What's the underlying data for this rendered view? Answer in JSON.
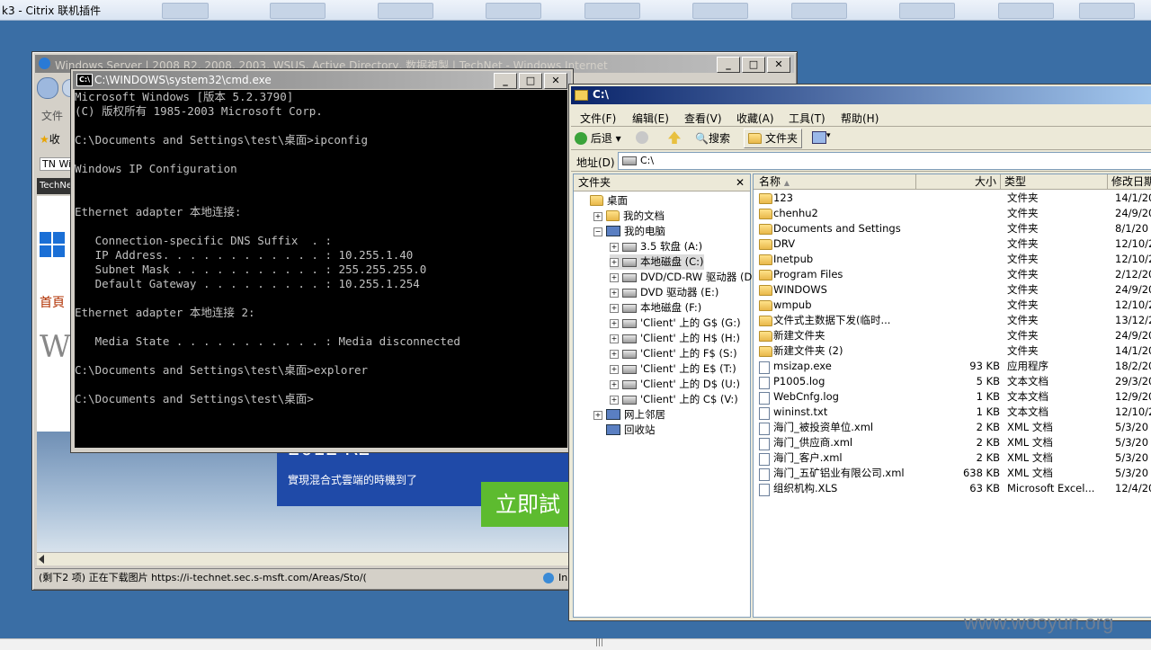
{
  "host": {
    "title": "k3 - Citrix 联机插件",
    "watermark": "www.wooyun.org"
  },
  "ie": {
    "title": "Windows Server | 2008 R2, 2008, 2003, WSUS, Active Directory, 数据複製 | TechNet - Windows Internet",
    "menu_left": "文件",
    "favorites": "收",
    "tab_label": "TN Wi",
    "site_label": "TechNe",
    "home_link": "首頁",
    "big_letter": "W",
    "banner_version": "2012 R2",
    "banner_subtitle": "實現混合式雲端的時機到了",
    "banner_button": "立即試",
    "status_text": "(剩下2 项) 正在下载图片 https://i-technet.sec.s-msft.com/Areas/Sto/(",
    "status_zone": "In"
  },
  "cmd": {
    "title": "C:\\WINDOWS\\system32\\cmd.exe",
    "lines": [
      "Microsoft Windows [版本 5.2.3790]",
      "(C) 版权所有 1985-2003 Microsoft Corp.",
      "",
      "C:\\Documents and Settings\\test\\桌面>ipconfig",
      "",
      "Windows IP Configuration",
      "",
      "",
      "Ethernet adapter 本地连接:",
      "",
      "   Connection-specific DNS Suffix  . :",
      "   IP Address. . . . . . . . . . . . : 10.255.1.40",
      "   Subnet Mask . . . . . . . . . . . : 255.255.255.0",
      "   Default Gateway . . . . . . . . . : 10.255.1.254",
      "",
      "Ethernet adapter 本地连接 2:",
      "",
      "   Media State . . . . . . . . . . . : Media disconnected",
      "",
      "C:\\Documents and Settings\\test\\桌面>explorer",
      "",
      "C:\\Documents and Settings\\test\\桌面>"
    ]
  },
  "explorer": {
    "title": "C:\\",
    "menu": [
      "文件(F)",
      "编辑(E)",
      "查看(V)",
      "收藏(A)",
      "工具(T)",
      "帮助(H)"
    ],
    "toolbar": {
      "back": "后退",
      "search": "搜索",
      "folders": "文件夹"
    },
    "address_label": "地址(D)",
    "address_value": "C:\\",
    "folders_pane_title": "文件夹",
    "tree": [
      {
        "label": "桌面",
        "icon": "desktop-icon",
        "expander": ""
      },
      {
        "label": "我的文档",
        "icon": "folder-icon",
        "expander": "+"
      },
      {
        "label": "我的电脑",
        "icon": "computer-icon",
        "expander": "-"
      },
      {
        "label": "3.5 软盘 (A:)",
        "icon": "floppy-icon",
        "expander": "+"
      },
      {
        "label": "本地磁盘 (C:)",
        "icon": "drive-icon",
        "expander": "+"
      },
      {
        "label": "DVD/CD-RW 驱动器 (D:)",
        "icon": "cd-drive-icon",
        "expander": "+"
      },
      {
        "label": "DVD 驱动器 (E:)",
        "icon": "cd-drive-icon",
        "expander": "+"
      },
      {
        "label": "本地磁盘 (F:)",
        "icon": "drive-icon",
        "expander": "+"
      },
      {
        "label": "'Client' 上的 G$ (G:)",
        "icon": "network-drive-icon",
        "expander": "+"
      },
      {
        "label": "'Client' 上的 H$ (H:)",
        "icon": "network-drive-icon",
        "expander": "+"
      },
      {
        "label": "'Client' 上的 F$ (S:)",
        "icon": "network-drive-icon",
        "expander": "+"
      },
      {
        "label": "'Client' 上的 E$ (T:)",
        "icon": "network-drive-icon",
        "expander": "+"
      },
      {
        "label": "'Client' 上的 D$ (U:)",
        "icon": "network-drive-icon",
        "expander": "+"
      },
      {
        "label": "'Client' 上的 C$ (V:)",
        "icon": "network-drive-icon",
        "expander": "+"
      },
      {
        "label": "网上邻居",
        "icon": "network-icon",
        "expander": "+"
      },
      {
        "label": "回收站",
        "icon": "recycle-bin-icon",
        "expander": ""
      }
    ],
    "columns": [
      "名称",
      "大小",
      "类型",
      "修改日期"
    ],
    "files": [
      {
        "name": "123",
        "size": "",
        "type": "文件夹",
        "date": "14/1/20",
        "kind": "folder"
      },
      {
        "name": "chenhu2",
        "size": "",
        "type": "文件夹",
        "date": "24/9/20",
        "kind": "folder"
      },
      {
        "name": "Documents and Settings",
        "size": "",
        "type": "文件夹",
        "date": "8/1/20",
        "kind": "folder"
      },
      {
        "name": "DRV",
        "size": "",
        "type": "文件夹",
        "date": "12/10/2",
        "kind": "folder"
      },
      {
        "name": "Inetpub",
        "size": "",
        "type": "文件夹",
        "date": "12/10/2",
        "kind": "folder"
      },
      {
        "name": "Program Files",
        "size": "",
        "type": "文件夹",
        "date": "2/12/20",
        "kind": "folder"
      },
      {
        "name": "WINDOWS",
        "size": "",
        "type": "文件夹",
        "date": "24/9/20",
        "kind": "folder"
      },
      {
        "name": "wmpub",
        "size": "",
        "type": "文件夹",
        "date": "12/10/2",
        "kind": "folder"
      },
      {
        "name": "文件式主数据下发(临时...",
        "size": "",
        "type": "文件夹",
        "date": "13/12/2",
        "kind": "folder"
      },
      {
        "name": "新建文件夹",
        "size": "",
        "type": "文件夹",
        "date": "24/9/20",
        "kind": "folder"
      },
      {
        "name": "新建文件夹 (2)",
        "size": "",
        "type": "文件夹",
        "date": "14/1/20",
        "kind": "folder"
      },
      {
        "name": "msizap.exe",
        "size": "93 KB",
        "type": "应用程序",
        "date": "18/2/20",
        "kind": "file"
      },
      {
        "name": "P1005.log",
        "size": "5 KB",
        "type": "文本文档",
        "date": "29/3/20",
        "kind": "file"
      },
      {
        "name": "WebCnfg.log",
        "size": "1 KB",
        "type": "文本文档",
        "date": "12/9/20",
        "kind": "file"
      },
      {
        "name": "wininst.txt",
        "size": "1 KB",
        "type": "文本文档",
        "date": "12/10/2",
        "kind": "file"
      },
      {
        "name": "海门_被投资单位.xml",
        "size": "2 KB",
        "type": "XML 文档",
        "date": "5/3/20",
        "kind": "file"
      },
      {
        "name": "海门_供应商.xml",
        "size": "2 KB",
        "type": "XML 文档",
        "date": "5/3/20",
        "kind": "file"
      },
      {
        "name": "海门_客户.xml",
        "size": "2 KB",
        "type": "XML 文档",
        "date": "5/3/20",
        "kind": "file"
      },
      {
        "name": "海门_五矿铝业有限公司.xml",
        "size": "638 KB",
        "type": "XML 文档",
        "date": "5/3/20",
        "kind": "file"
      },
      {
        "name": "组织机构.XLS",
        "size": "63 KB",
        "type": "Microsoft Excel...",
        "date": "12/4/20",
        "kind": "file"
      }
    ]
  },
  "colors": {
    "desktop": "#3a6ea5",
    "titlebar_active": "#0a246a",
    "cmd_bg": "#000000",
    "cmd_fg": "#c0c0c0",
    "banner_blue": "#1f4aa8",
    "banner_green": "#5dbb2f"
  }
}
